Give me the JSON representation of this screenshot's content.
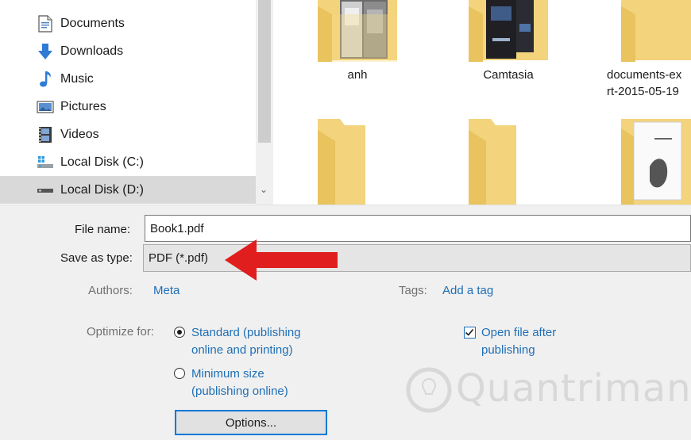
{
  "nav": {
    "items": [
      {
        "label": "Documents",
        "icon": "documents-icon"
      },
      {
        "label": "Downloads",
        "icon": "download-arrow-icon"
      },
      {
        "label": "Music",
        "icon": "music-note-icon"
      },
      {
        "label": "Pictures",
        "icon": "pictures-icon"
      },
      {
        "label": "Videos",
        "icon": "videos-icon"
      },
      {
        "label": "Local Disk (C:)",
        "icon": "windows-drive-icon"
      },
      {
        "label": "Local Disk (D:)",
        "icon": "drive-icon",
        "selected": true
      }
    ]
  },
  "files": {
    "items": [
      {
        "label_line1": "anh",
        "label_line2": ""
      },
      {
        "label_line1": "Camtasia",
        "label_line2": ""
      },
      {
        "label_line1": "documents-ex",
        "label_line2": "rt-2015-05-19"
      },
      {
        "label_line1": "",
        "label_line2": ""
      },
      {
        "label_line1": "",
        "label_line2": ""
      },
      {
        "label_line1": "",
        "label_line2": ""
      }
    ]
  },
  "form": {
    "file_name_label": "File name:",
    "file_name_value": "Book1.pdf",
    "save_type_label": "Save as type:",
    "save_type_value": "PDF (*.pdf)",
    "authors_label": "Authors:",
    "authors_value": "Meta",
    "tags_label": "Tags:",
    "tags_value": "Add a tag",
    "optimize_label": "Optimize for:",
    "standard_line1": "Standard (publishing",
    "standard_line2": "online and printing)",
    "minimum_line1": "Minimum size",
    "minimum_line2": "(publishing online)",
    "open_after_line1": "Open file after",
    "open_after_line2": "publishing",
    "options_button": "Options..."
  },
  "watermark": "Quantrimang",
  "colors": {
    "accent": "#0078d7",
    "link": "#1f6fb5",
    "arrow": "#e01e1e",
    "folder": "#f3d37b",
    "selection": "#d9d9d9"
  }
}
